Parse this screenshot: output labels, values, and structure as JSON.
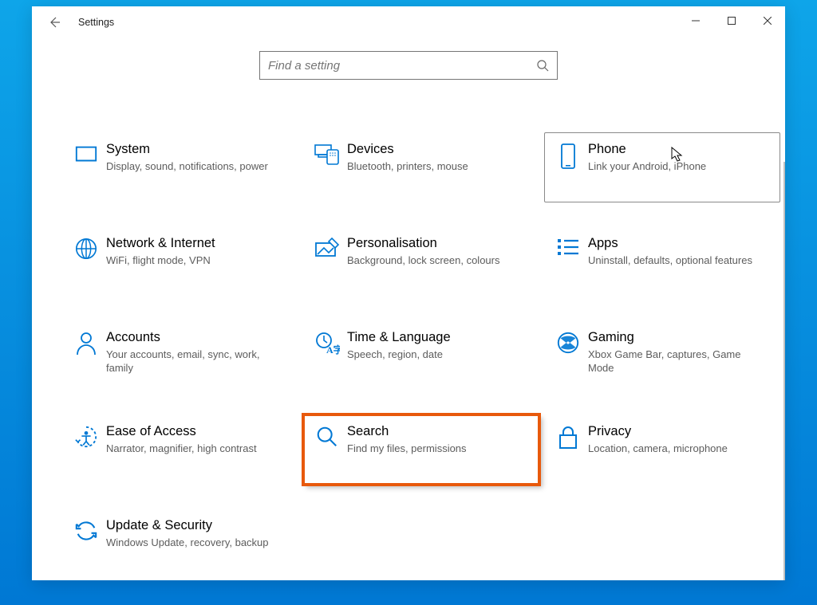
{
  "window": {
    "title": "Settings"
  },
  "search": {
    "placeholder": "Find a setting"
  },
  "tiles": {
    "system": {
      "title": "System",
      "desc": "Display, sound, notifications, power"
    },
    "devices": {
      "title": "Devices",
      "desc": "Bluetooth, printers, mouse"
    },
    "phone": {
      "title": "Phone",
      "desc": "Link your Android, iPhone"
    },
    "network": {
      "title": "Network & Internet",
      "desc": "WiFi, flight mode, VPN"
    },
    "personalisation": {
      "title": "Personalisation",
      "desc": "Background, lock screen, colours"
    },
    "apps": {
      "title": "Apps",
      "desc": "Uninstall, defaults, optional features"
    },
    "accounts": {
      "title": "Accounts",
      "desc": "Your accounts, email, sync, work, family"
    },
    "time": {
      "title": "Time & Language",
      "desc": "Speech, region, date"
    },
    "gaming": {
      "title": "Gaming",
      "desc": "Xbox Game Bar, captures, Game Mode"
    },
    "ease": {
      "title": "Ease of Access",
      "desc": "Narrator, magnifier, high contrast"
    },
    "search": {
      "title": "Search",
      "desc": "Find my files, permissions"
    },
    "privacy": {
      "title": "Privacy",
      "desc": "Location, camera, microphone"
    },
    "update": {
      "title": "Update & Security",
      "desc": "Windows Update, recovery, backup"
    }
  },
  "highlighted_tile": "search",
  "hovered_tile": "phone",
  "accent_color": "#0078d4",
  "highlight_color": "#e8590c"
}
